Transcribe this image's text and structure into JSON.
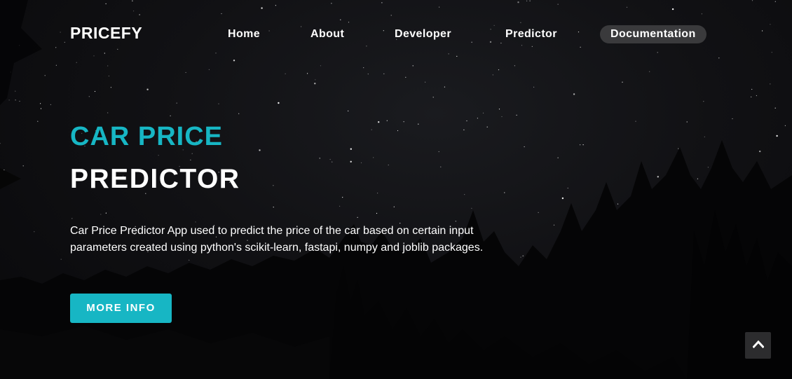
{
  "brand": "PRICEFY",
  "nav": {
    "items": [
      {
        "label": "Home"
      },
      {
        "label": "About"
      },
      {
        "label": "Developer"
      },
      {
        "label": "Predictor"
      },
      {
        "label": "Documentation",
        "active": true
      }
    ]
  },
  "hero": {
    "title_line1": "CAR PRICE",
    "title_line2": "PREDICTOR",
    "description": "Car Price Predictor App used to predict the price of the car based on certain input parameters created using python's scikit-learn, fastapi, numpy and joblib packages.",
    "button_label": "MORE INFO"
  },
  "scroll_top": {
    "icon": "chevron-up-icon"
  },
  "colors": {
    "accent": "#17b6c4",
    "background": "#0c0c0e",
    "nav_active_bg": "#3a3a3c",
    "text": "#ffffff"
  }
}
